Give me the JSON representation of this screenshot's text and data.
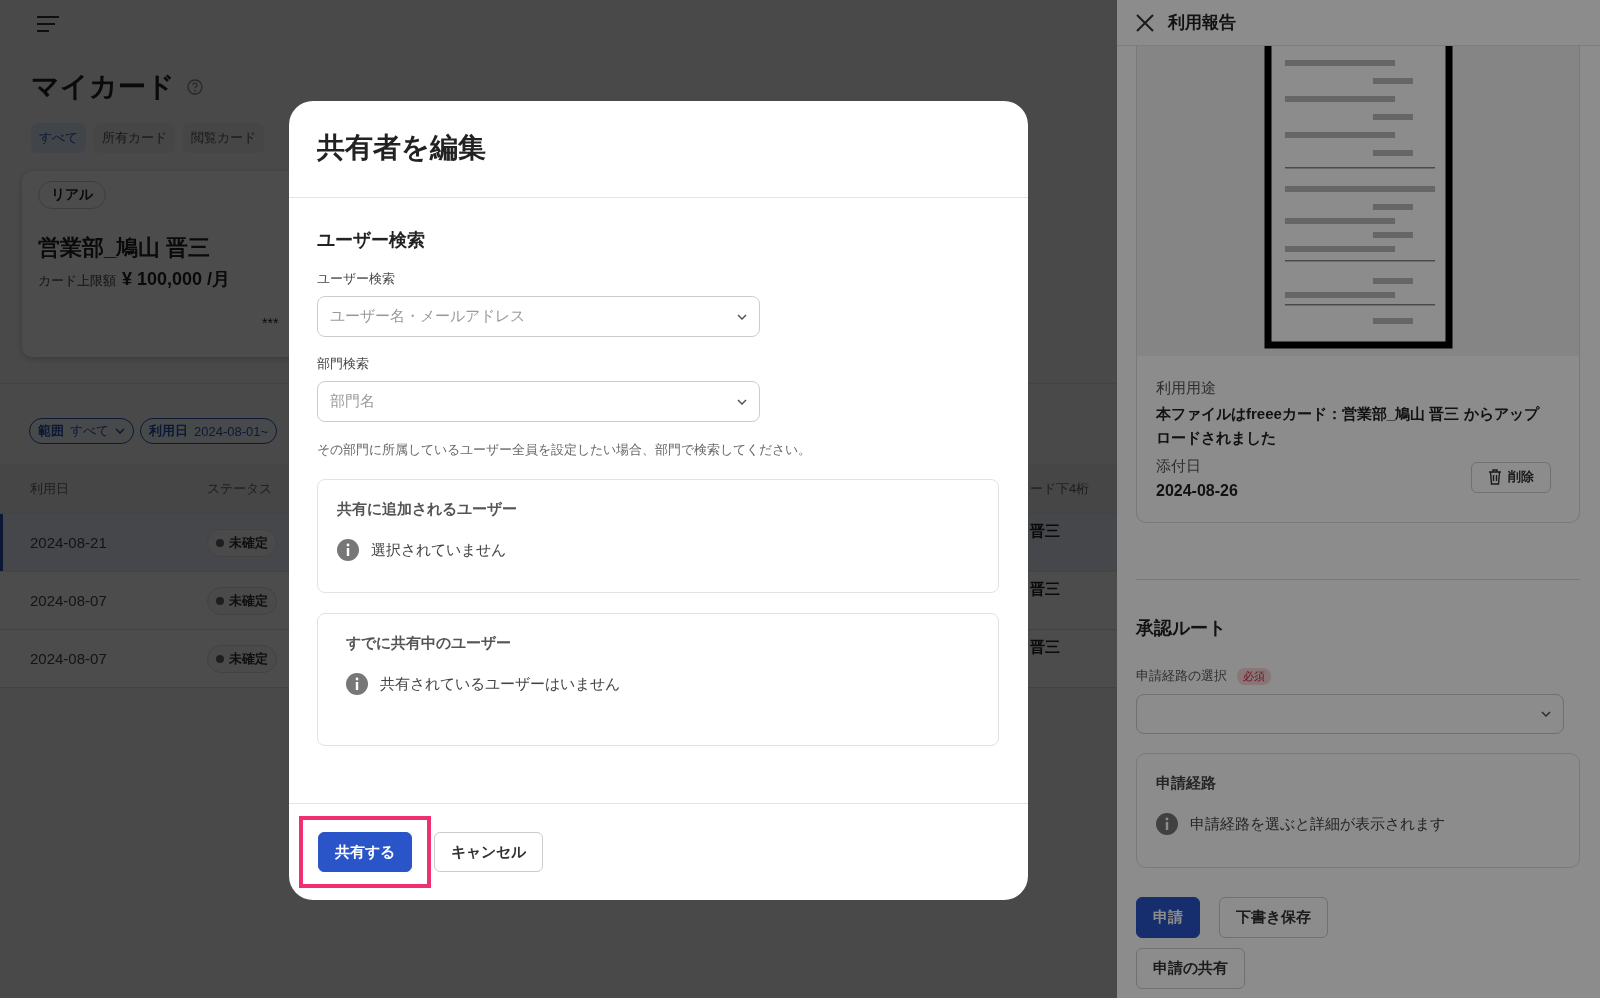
{
  "page": {
    "title": "マイカード"
  },
  "filter_tabs": [
    {
      "label": "すべて",
      "selected": true
    },
    {
      "label": "所有カード",
      "selected": false
    },
    {
      "label": "閲覧カード",
      "selected": false
    }
  ],
  "card": {
    "badge": "リアル",
    "holder": "営業部_鳩山 晋三",
    "limit_label": "カード上限額",
    "limit_amount": "¥ 100,000 /月",
    "number": "***"
  },
  "filters": [
    {
      "label": "範囲",
      "value": "すべて",
      "dropdown": true
    },
    {
      "label": "利用日",
      "value": "2024-08-01~",
      "dropdown": false
    }
  ],
  "table": {
    "columns": [
      "利用日",
      "ステータス",
      "ード下4桁"
    ],
    "rows": [
      {
        "date": "2024-08-21",
        "status": "未確定",
        "column_3": "晋三",
        "selected": true
      },
      {
        "date": "2024-08-07",
        "status": "未確定",
        "column_3": "晋三",
        "selected": false
      },
      {
        "date": "2024-08-07",
        "status": "未確定",
        "column_3": "晋三",
        "selected": false
      }
    ]
  },
  "side_panel": {
    "title": "利用報告",
    "purpose_label": "利用用途",
    "purpose": "本ファイルはfreeeカード：営業部_鳩山 晋三 からアップロードされました",
    "date_label": "添付日",
    "date": "2024-08-26",
    "delete_button": "削除",
    "approval": {
      "heading": "承認ルート",
      "select_label": "申請経路の選択",
      "required_badge": "必須",
      "route_box": {
        "title": "申請経路",
        "info": "申請経路を選ぶと詳細が表示されます"
      }
    },
    "buttons": [
      {
        "label": "申請",
        "primary": true
      },
      {
        "label": "下書き保存",
        "primary": false
      },
      {
        "label": "申請の共有",
        "primary": false
      }
    ]
  },
  "dialog": {
    "title": "共有者を編集",
    "section": "ユーザー検索",
    "fields": [
      {
        "label": "ユーザー検索",
        "placeholder": "ユーザー名・メールアドレス"
      },
      {
        "label": "部門検索",
        "placeholder": "部門名"
      }
    ],
    "hint": "その部門に所属しているユーザー全員を設定したい場合、部門で検索してください。",
    "boxes": [
      {
        "title": "共有に追加されるユーザー",
        "info": "選択されていません"
      },
      {
        "title": "すでに共有中のユーザー",
        "info": "共有されているユーザーはいません"
      }
    ],
    "buttons": [
      {
        "label": "共有する",
        "primary": true,
        "highlighted": true
      },
      {
        "label": "キャンセル",
        "primary": false,
        "highlighted": false
      }
    ]
  }
}
